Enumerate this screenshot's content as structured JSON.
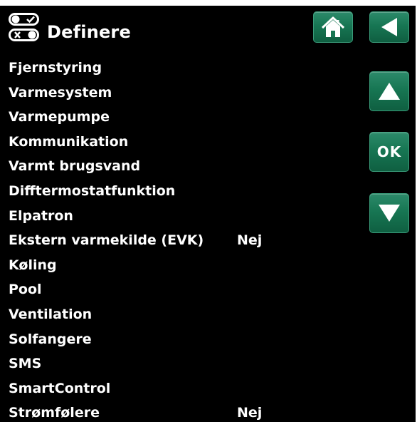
{
  "header": {
    "title": "Definere",
    "icon": "toggle-settings-icon"
  },
  "buttons": {
    "home": "home-icon",
    "back": "back-arrow-icon",
    "up": "up-arrow-icon",
    "ok_label": "OK",
    "down": "down-arrow-icon"
  },
  "colors": {
    "background": "#000000",
    "text": "#ffffff",
    "button": "#177653"
  },
  "menu": {
    "items": [
      {
        "label": "Fjernstyring",
        "value": ""
      },
      {
        "label": "Varmesystem",
        "value": ""
      },
      {
        "label": "Varmepumpe",
        "value": ""
      },
      {
        "label": "Kommunikation",
        "value": ""
      },
      {
        "label": "Varmt brugsvand",
        "value": ""
      },
      {
        "label": "Difftermostatfunktion",
        "value": ""
      },
      {
        "label": "Elpatron",
        "value": ""
      },
      {
        "label": "Ekstern varmekilde (EVK)",
        "value": "Nej"
      },
      {
        "label": "Køling",
        "value": ""
      },
      {
        "label": "Pool",
        "value": ""
      },
      {
        "label": "Ventilation",
        "value": ""
      },
      {
        "label": "Solfangere",
        "value": ""
      },
      {
        "label": "SMS",
        "value": ""
      },
      {
        "label": "SmartControl",
        "value": ""
      },
      {
        "label": "Strømfølere",
        "value": "Nej"
      }
    ]
  }
}
